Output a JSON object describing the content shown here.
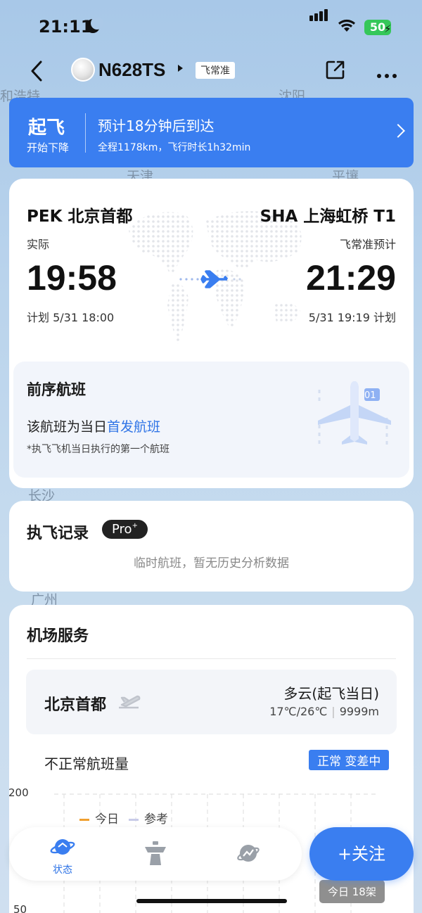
{
  "status_bar": {
    "time": "21:11",
    "battery": "50"
  },
  "map_labels": [
    "和浩特",
    "沈阳",
    "天津",
    "平壤",
    "长沙",
    "广州"
  ],
  "header": {
    "flight_no": "N628TS",
    "tag": "飞常准"
  },
  "banner": {
    "status": "起飞",
    "status_sub": "开始下降",
    "headline": "预计18分钟后到达",
    "detail": "全程1178km，飞行时长1h32min"
  },
  "route": {
    "dep_city": "PEK 北京首都",
    "arr_city": "SHA 上海虹桥 T1",
    "dep_label": "实际",
    "arr_label": "飞常准预计",
    "dep_time": "19:58",
    "arr_time": "21:29",
    "dep_plan": "计划 5/31 18:00",
    "arr_plan": "5/31 19:19 计划"
  },
  "previous_flight": {
    "title": "前序航班",
    "desc_prefix": "该航班为当日",
    "desc_link": "首发航班",
    "note": "*执飞飞机当日执行的第一个航班",
    "badge": "01"
  },
  "history": {
    "title": "执飞记录",
    "pro_label": "Pro",
    "message": "临时航班，暂无历史分析数据"
  },
  "airport": {
    "title": "机场服务",
    "city": "北京首都",
    "weather": "多云(起飞当日)",
    "temp": "17℃/26℃",
    "visibility": "9999m",
    "irregular_label": "不正常航班量",
    "status_badge": "正常 变差中"
  },
  "chart_data": {
    "type": "line",
    "y_ticks": [
      "200",
      "50"
    ],
    "legend": [
      {
        "name": "今日",
        "color": "#f0a030"
      },
      {
        "name": "参考",
        "color": "#c8cbe8"
      }
    ],
    "today_tip": "今日 18架"
  },
  "tabbar": {
    "status_label": "状态"
  },
  "follow_button": "+关注",
  "colors": {
    "accent": "#3a7ef0",
    "link": "#2f74e6"
  }
}
